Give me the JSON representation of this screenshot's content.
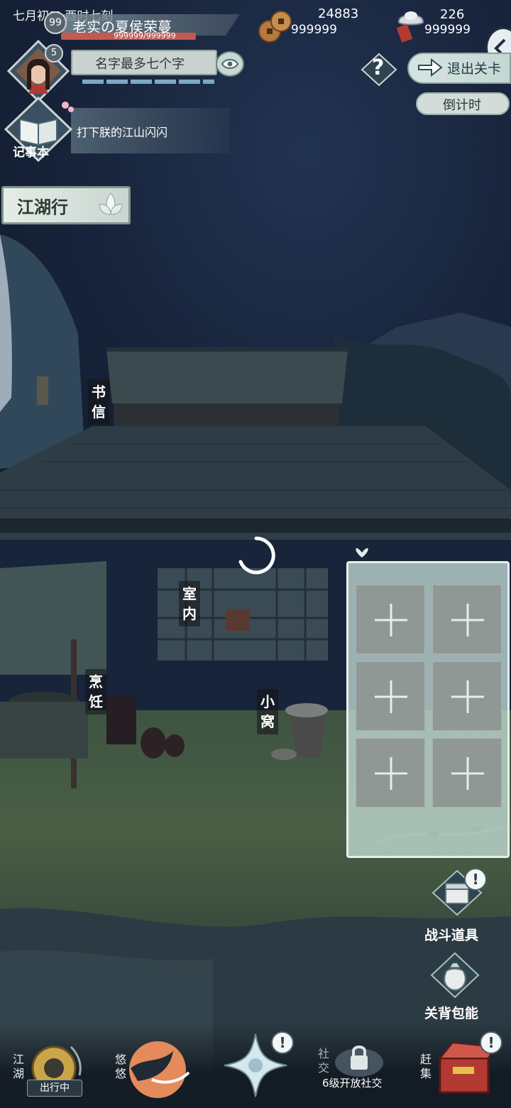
{
  "hud": {
    "date_time": "七月初二 酉时七刻",
    "rank_level": "99",
    "character_name": "老实の夏侯荣蔓",
    "hp_text": "999999/999999",
    "player_level": "5",
    "name_plate": "名字最多七个字",
    "help_label": "?",
    "exit_label": "退出关卡",
    "countdown_label": "倒计时"
  },
  "currency": {
    "copper_value": "24883",
    "copper_sub": "999999",
    "silver_value": "226",
    "silver_sub": "999999"
  },
  "journal": {
    "label": "记事本",
    "task_text": "打下朕的江山闪闪"
  },
  "jianghu_button": "江湖行",
  "locations": {
    "letters": "书信",
    "indoor": "室内",
    "cooking": "烹饪",
    "nest": "小窝"
  },
  "quick_items": {
    "slots": [
      "+",
      "+",
      "+",
      "+",
      "+",
      "+"
    ]
  },
  "side_buttons": {
    "battle_items": "战斗道具",
    "bag": "关背包能",
    "alert_mark": "!"
  },
  "bottom_nav": {
    "jianghu_vertical": "江湖",
    "outing_tag": "出行中",
    "youyou_vertical": "悠悠",
    "social_vertical": "社交",
    "social_lock": "6级开放社交",
    "market_vertical": "赶集"
  },
  "colors": {
    "hp_red": "#c25a52",
    "panel_mint": "#c8e0da",
    "night_sky": "#17233a"
  },
  "icons": {
    "copper": "copper-coin-icon",
    "silver": "silver-ingot-icon",
    "journal": "book-icon",
    "help": "question-icon",
    "exit": "exit-arrow-icon",
    "eye": "eye-icon",
    "collapse": "chevron-left-icon",
    "battle": "chest-icon",
    "bag": "pouch-icon"
  }
}
